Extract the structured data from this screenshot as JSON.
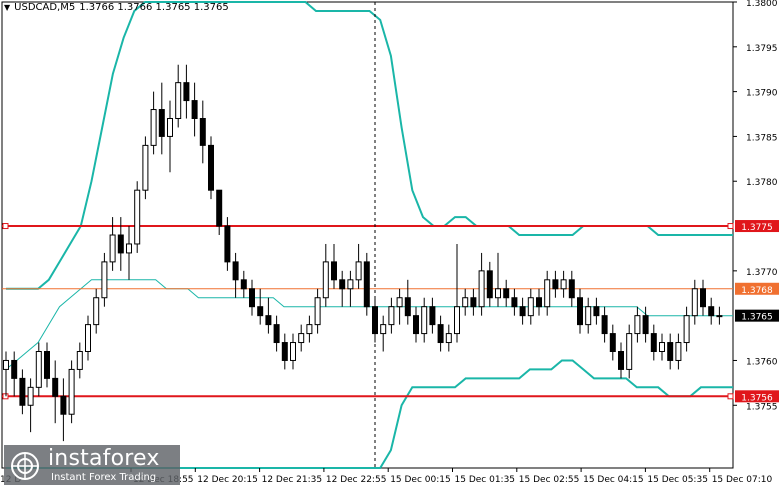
{
  "header": {
    "symbol": "USDCAD,M5",
    "ohlc": "1.3766 1.3766 1.3765 1.3765"
  },
  "logo": {
    "brand": "instaforex",
    "tagline": "Instant Forex Trading"
  },
  "chart_data": {
    "type": "candlestick",
    "symbol": "USDCAD",
    "timeframe": "M5",
    "ylim": [
      1.3748,
      1.38
    ],
    "y_ticks": [
      "1.3800",
      "1.3795",
      "1.3790",
      "1.3785",
      "1.3780",
      "1.3770",
      "1.3760",
      "1.3755"
    ],
    "x_tick_labels": [
      "12 Dec 18:55",
      "12 Dec 20:15",
      "12 Dec 21:35",
      "12 Dec 22:55",
      "15 Dec 00:15",
      "15 Dec 01:35",
      "15 Dec 02:55",
      "15 Dec 04:15",
      "15 Dec 05:35",
      "15 Dec 07:10"
    ],
    "first_x_label_partial": "12 D",
    "levels": [
      {
        "price": 1.3775,
        "label": "1.3775",
        "color": "#e0161b",
        "style": "bold"
      },
      {
        "price": 1.3768,
        "label": "1.3768",
        "color": "#f07030",
        "style": "thin"
      },
      {
        "price": 1.3756,
        "label": "1.3756",
        "color": "#e0161b",
        "style": "bold"
      }
    ],
    "current_price": {
      "price": 1.3765,
      "label": "1.3765",
      "bg": "#000000"
    },
    "colors": {
      "bull": "#ffffff",
      "bear": "#000000",
      "wick": "#000000",
      "bands": "#1ab6a8",
      "ma": "#1ab6a8",
      "grid": "#ffffff"
    },
    "candles": [
      [
        1.3759,
        1.3761,
        1.3756,
        1.376
      ],
      [
        1.376,
        1.3761,
        1.3756,
        1.3758
      ],
      [
        1.3758,
        1.3759,
        1.3754,
        1.3755
      ],
      [
        1.3755,
        1.3758,
        1.3752,
        1.3757
      ],
      [
        1.3757,
        1.3762,
        1.3756,
        1.3761
      ],
      [
        1.3761,
        1.3762,
        1.3757,
        1.3758
      ],
      [
        1.3758,
        1.376,
        1.3753,
        1.3756
      ],
      [
        1.3756,
        1.3758,
        1.3751,
        1.3754
      ],
      [
        1.3754,
        1.376,
        1.3753,
        1.3759
      ],
      [
        1.3759,
        1.3762,
        1.3758,
        1.3761
      ],
      [
        1.3761,
        1.3765,
        1.376,
        1.3764
      ],
      [
        1.3764,
        1.3768,
        1.3763,
        1.3767
      ],
      [
        1.3767,
        1.3772,
        1.3766,
        1.3771
      ],
      [
        1.3771,
        1.3776,
        1.377,
        1.3774
      ],
      [
        1.3774,
        1.3776,
        1.377,
        1.3772
      ],
      [
        1.3772,
        1.3775,
        1.3769,
        1.3773
      ],
      [
        1.3773,
        1.378,
        1.3772,
        1.3779
      ],
      [
        1.3779,
        1.3785,
        1.3778,
        1.3784
      ],
      [
        1.3784,
        1.379,
        1.3783,
        1.3788
      ],
      [
        1.3788,
        1.3791,
        1.3783,
        1.3785
      ],
      [
        1.3785,
        1.3789,
        1.3781,
        1.3787
      ],
      [
        1.3787,
        1.3793,
        1.3786,
        1.3791
      ],
      [
        1.3791,
        1.3793,
        1.3787,
        1.3789
      ],
      [
        1.3789,
        1.3791,
        1.3785,
        1.3787
      ],
      [
        1.3787,
        1.3789,
        1.3782,
        1.3784
      ],
      [
        1.3784,
        1.3785,
        1.3778,
        1.3779
      ],
      [
        1.3779,
        1.3779,
        1.3774,
        1.3775
      ],
      [
        1.3775,
        1.3776,
        1.377,
        1.3771
      ],
      [
        1.3771,
        1.3772,
        1.3767,
        1.3769
      ],
      [
        1.3769,
        1.377,
        1.3767,
        1.3768
      ],
      [
        1.3768,
        1.3769,
        1.3765,
        1.3766
      ],
      [
        1.3766,
        1.3768,
        1.3764,
        1.3765
      ],
      [
        1.3765,
        1.3767,
        1.3763,
        1.3764
      ],
      [
        1.3764,
        1.3765,
        1.3761,
        1.3762
      ],
      [
        1.3762,
        1.3763,
        1.3759,
        1.376
      ],
      [
        1.376,
        1.3763,
        1.3759,
        1.3762
      ],
      [
        1.3762,
        1.3764,
        1.3761,
        1.3763
      ],
      [
        1.3763,
        1.3765,
        1.3762,
        1.3764
      ],
      [
        1.3764,
        1.3768,
        1.3763,
        1.3767
      ],
      [
        1.3767,
        1.3773,
        1.3766,
        1.3771
      ],
      [
        1.3771,
        1.3773,
        1.3768,
        1.3769
      ],
      [
        1.3769,
        1.377,
        1.3766,
        1.3768
      ],
      [
        1.3768,
        1.377,
        1.3766,
        1.3769
      ],
      [
        1.3769,
        1.3773,
        1.3768,
        1.3771
      ],
      [
        1.3771,
        1.3772,
        1.3765,
        1.3766
      ],
      [
        1.3766,
        1.3767,
        1.3762,
        1.3763
      ],
      [
        1.3763,
        1.3765,
        1.3761,
        1.3764
      ],
      [
        1.3764,
        1.3767,
        1.3763,
        1.3766
      ],
      [
        1.3766,
        1.3768,
        1.3764,
        1.3767
      ],
      [
        1.3767,
        1.3769,
        1.3764,
        1.3765
      ],
      [
        1.3765,
        1.3766,
        1.3762,
        1.3763
      ],
      [
        1.3763,
        1.3767,
        1.3762,
        1.3766
      ],
      [
        1.3766,
        1.3767,
        1.3763,
        1.3764
      ],
      [
        1.3764,
        1.3765,
        1.3761,
        1.3762
      ],
      [
        1.3762,
        1.3764,
        1.3761,
        1.3763
      ],
      [
        1.3763,
        1.3773,
        1.3762,
        1.3766
      ],
      [
        1.3766,
        1.3768,
        1.3765,
        1.3767
      ],
      [
        1.3767,
        1.3768,
        1.3765,
        1.3766
      ],
      [
        1.3766,
        1.3772,
        1.3765,
        1.377
      ],
      [
        1.377,
        1.3771,
        1.3766,
        1.3767
      ],
      [
        1.3767,
        1.3772,
        1.3766,
        1.3768
      ],
      [
        1.3768,
        1.3769,
        1.3766,
        1.3767
      ],
      [
        1.3767,
        1.3768,
        1.3765,
        1.3766
      ],
      [
        1.3766,
        1.3767,
        1.3764,
        1.3765
      ],
      [
        1.3765,
        1.3768,
        1.3764,
        1.3767
      ],
      [
        1.3767,
        1.3768,
        1.3765,
        1.3766
      ],
      [
        1.3766,
        1.377,
        1.3765,
        1.3769
      ],
      [
        1.3769,
        1.377,
        1.3767,
        1.3768
      ],
      [
        1.3768,
        1.377,
        1.3767,
        1.3769
      ],
      [
        1.3769,
        1.377,
        1.3766,
        1.3767
      ],
      [
        1.3767,
        1.3768,
        1.3763,
        1.3764
      ],
      [
        1.3764,
        1.3767,
        1.3763,
        1.3766
      ],
      [
        1.3766,
        1.3767,
        1.3764,
        1.3765
      ],
      [
        1.3765,
        1.3766,
        1.3762,
        1.3763
      ],
      [
        1.3763,
        1.3764,
        1.376,
        1.3761
      ],
      [
        1.3761,
        1.3762,
        1.3758,
        1.3759
      ],
      [
        1.3759,
        1.3764,
        1.3758,
        1.3763
      ],
      [
        1.3763,
        1.3766,
        1.3762,
        1.3765
      ],
      [
        1.3765,
        1.3766,
        1.3762,
        1.3763
      ],
      [
        1.3763,
        1.3764,
        1.376,
        1.3761
      ],
      [
        1.3761,
        1.3763,
        1.376,
        1.3762
      ],
      [
        1.3762,
        1.3763,
        1.3759,
        1.376
      ],
      [
        1.376,
        1.3763,
        1.3759,
        1.3762
      ],
      [
        1.3762,
        1.3766,
        1.3761,
        1.3765
      ],
      [
        1.3765,
        1.3769,
        1.3764,
        1.3768
      ],
      [
        1.3768,
        1.3769,
        1.3765,
        1.3766
      ],
      [
        1.3766,
        1.3767,
        1.3764,
        1.3765
      ],
      [
        1.3765,
        1.3766,
        1.3764,
        1.3765
      ]
    ],
    "bands": {
      "upper": [
        1.3768,
        1.3768,
        1.3768,
        1.3768,
        1.3769,
        1.3771,
        1.3773,
        1.3775,
        1.378,
        1.3786,
        1.3792,
        1.3796,
        1.3799,
        1.38,
        1.38,
        1.38,
        1.38,
        1.38,
        1.38,
        1.38,
        1.38,
        1.38,
        1.38,
        1.38,
        1.38,
        1.38,
        1.38,
        1.38,
        1.38,
        1.3799,
        1.3799,
        1.3799,
        1.3799,
        1.3799,
        1.3799,
        1.3798,
        1.3794,
        1.3786,
        1.3779,
        1.3776,
        1.3775,
        1.3775,
        1.3776,
        1.3776,
        1.3775,
        1.3775,
        1.3775,
        1.3775,
        1.3774,
        1.3774,
        1.3774,
        1.3774,
        1.3774,
        1.3774,
        1.3775,
        1.3775,
        1.3775,
        1.3775,
        1.3775,
        1.3775,
        1.3775,
        1.3774,
        1.3774,
        1.3774,
        1.3774,
        1.3774,
        1.3774,
        1.3774,
        1.3774
      ],
      "lower": [
        1.3745,
        1.3745,
        1.3745,
        1.3745,
        1.3745,
        1.3745,
        1.3745,
        1.3745,
        1.3745,
        1.3745,
        1.3745,
        1.3745,
        1.3745,
        1.3745,
        1.3745,
        1.3745,
        1.3745,
        1.3745,
        1.3745,
        1.3745,
        1.3745,
        1.3745,
        1.3745,
        1.3745,
        1.3745,
        1.3745,
        1.3745,
        1.3745,
        1.3745,
        1.3745,
        1.3745,
        1.3745,
        1.3745,
        1.3745,
        1.3745,
        1.3745,
        1.375,
        1.3755,
        1.3757,
        1.3757,
        1.3757,
        1.3757,
        1.3757,
        1.3758,
        1.3758,
        1.3758,
        1.3758,
        1.3758,
        1.3758,
        1.3759,
        1.3759,
        1.3759,
        1.376,
        1.376,
        1.3759,
        1.3758,
        1.3758,
        1.3758,
        1.3758,
        1.3757,
        1.3757,
        1.3757,
        1.3756,
        1.3756,
        1.3756,
        1.3757,
        1.3757,
        1.3757,
        1.3757
      ],
      "ma": [
        1.3759,
        1.376,
        1.3761,
        1.3762,
        1.3764,
        1.3766,
        1.3767,
        1.3768,
        1.3769,
        1.3769,
        1.3769,
        1.3769,
        1.3769,
        1.3769,
        1.3769,
        1.3768,
        1.3768,
        1.3768,
        1.3767,
        1.3767,
        1.3767,
        1.3767,
        1.3767,
        1.3767,
        1.3767,
        1.3767,
        1.3766,
        1.3766,
        1.3766,
        1.3766,
        1.3766,
        1.3766,
        1.3766,
        1.3766,
        1.3766,
        1.3766,
        1.3766,
        1.3766,
        1.3766,
        1.3766,
        1.3766,
        1.3766,
        1.3766,
        1.3766,
        1.3766,
        1.3766,
        1.3766,
        1.3766,
        1.3766,
        1.3766,
        1.3766,
        1.3766,
        1.3766,
        1.3766,
        1.3766,
        1.3766,
        1.3766,
        1.3766,
        1.3766,
        1.3766,
        1.3765,
        1.3765,
        1.3765,
        1.3765,
        1.3765,
        1.3765,
        1.3765,
        1.3765,
        1.3765
      ]
    }
  }
}
